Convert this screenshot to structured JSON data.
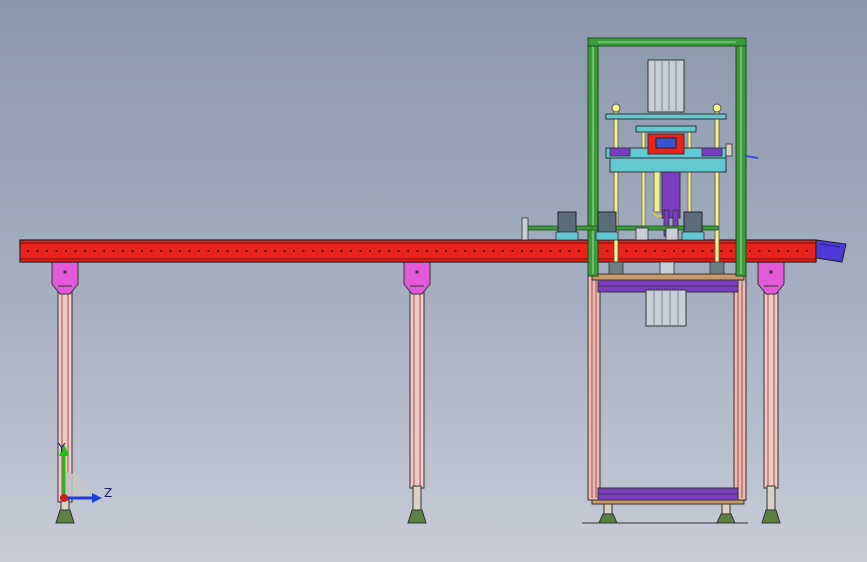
{
  "view": {
    "type": "CAD assembly front view",
    "background_top": "#8b97ac",
    "background_bottom": "#c8ccd7"
  },
  "triad": {
    "y_axis_label": "Y",
    "z_axis_label": "Z",
    "y_color": "#19c219",
    "z_color": "#1f3fd6",
    "origin_color": "#d11a1a"
  },
  "colors": {
    "conveyor": "#e8231b",
    "conveyor_dots": "#5a0c08",
    "leg_bracket": "#e35ad8",
    "leg_post": "#f2c9c4",
    "frame_green": "#3c9c3c",
    "frame_pink": "#f0b8b0",
    "rod_yellow": "#f3f08a",
    "plate_teal": "#62c9d3",
    "plate_purple": "#7a3dc0",
    "motor_grey": "#c9cfd8",
    "end_cap": "#4d3ad6",
    "base_plate": "#c89a6a"
  }
}
